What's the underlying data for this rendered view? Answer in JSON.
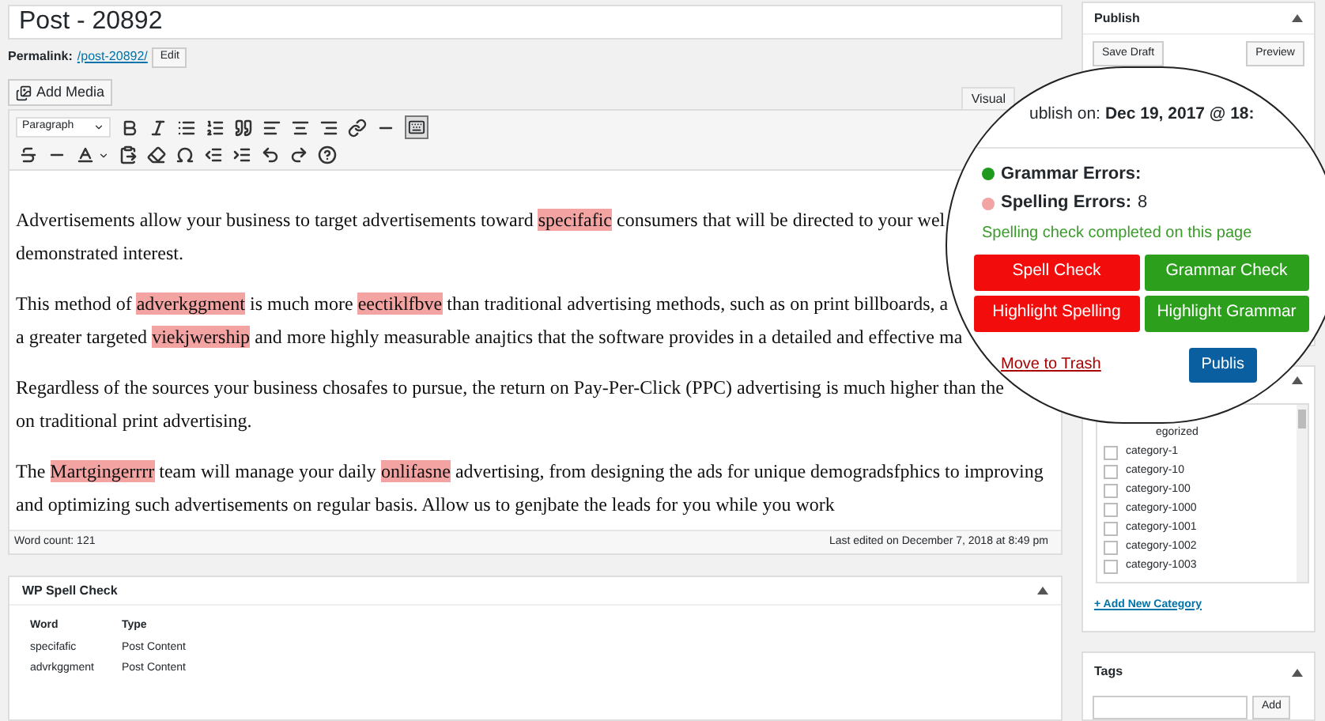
{
  "title_field": {
    "value": "Post - 20892"
  },
  "permalink": {
    "label": "Permalink:",
    "url": "/post-20892/",
    "button": "Edit"
  },
  "add_media_button": "Add Media",
  "editor_tabs": [
    {
      "label": "Visual",
      "selected": true
    }
  ],
  "toolbar": {
    "format_select": "Paragraph"
  },
  "content": {
    "paragraphs": [
      {
        "lines": [
          [
            {
              "text": "Advertisements allow your business to target advertisements toward ",
              "misspelled": false
            },
            {
              "text": "specifafic",
              "misspelled": true
            },
            {
              "text": " consumers that will be directed to your wel",
              "misspelled": false
            }
          ],
          [
            {
              "text": "demonstrated interest.",
              "misspelled": false
            }
          ]
        ]
      },
      {
        "lines": [
          [
            {
              "text": "This method of ",
              "misspelled": false
            },
            {
              "text": "adverkggment",
              "misspelled": true
            },
            {
              "text": " is much more ",
              "misspelled": false
            },
            {
              "text": "eectiklfbve",
              "misspelled": true
            },
            {
              "text": " than traditional advertising methods, such as on print billboards, a",
              "misspelled": false
            }
          ],
          [
            {
              "text": "a greater targeted ",
              "misspelled": false
            },
            {
              "text": "viekjwership",
              "misspelled": true
            },
            {
              "text": " and more highly measurable anajtics that the software provides in a detailed and effective ma",
              "misspelled": false
            }
          ]
        ]
      },
      {
        "lines": [
          [
            {
              "text": "Regardless of the sources your business chosafes to pursue, the return on Pay-Per-Click (PPC) advertising is much higher than the",
              "misspelled": false
            }
          ],
          [
            {
              "text": "on traditional print advertising.",
              "misspelled": false
            }
          ]
        ]
      },
      {
        "lines": [
          [
            {
              "text": "The ",
              "misspelled": false
            },
            {
              "text": "Martgingerrrr",
              "misspelled": true
            },
            {
              "text": " team will manage your daily ",
              "misspelled": false
            },
            {
              "text": "onlifasne",
              "misspelled": true
            },
            {
              "text": " advertising, from designing the ads for unique demogradsfphics to improving",
              "misspelled": false
            }
          ],
          [
            {
              "text": "and optimizing such advertisements on regular basis. Allow us to genjbate the leads for you while you work",
              "misspelled": false
            }
          ]
        ]
      }
    ]
  },
  "status_bar": {
    "word_count": "Word count: 121",
    "last_edited": "Last edited on December 7, 2018 at 8:49 pm"
  },
  "spell_panel": {
    "title": "WP Spell Check",
    "columns": [
      "Word",
      "Type"
    ],
    "rows": [
      [
        "specifafic",
        "Post Content"
      ],
      [
        "advrkggment",
        "Post Content"
      ]
    ]
  },
  "publish_panel": {
    "title": "Publish",
    "buttons": [
      "Save Draft",
      "Preview"
    ]
  },
  "categories_panel": {
    "items": [
      {
        "label": "egorized",
        "kind": "partial"
      },
      {
        "label": "category-1",
        "kind": "checkbox",
        "checked": false
      },
      {
        "label": "category-10",
        "kind": "checkbox",
        "checked": false
      },
      {
        "label": "category-100",
        "kind": "checkbox",
        "checked": false
      },
      {
        "label": "category-1000",
        "kind": "checkbox",
        "checked": false
      },
      {
        "label": "category-1001",
        "kind": "checkbox",
        "checked": false
      },
      {
        "label": "category-1002",
        "kind": "checkbox",
        "checked": false
      },
      {
        "label": "category-1003",
        "kind": "checkbox",
        "checked": false
      }
    ],
    "add_link": "+ Add New Category"
  },
  "tags_panel": {
    "title": "Tags",
    "button": "Add"
  },
  "magnifier": {
    "publish_on_label": "ublish on:",
    "publish_on_value": "Dec 19, 2017 @ 18:",
    "counts": [
      {
        "label": "Grammar Errors:",
        "color": "#1f9a1f"
      },
      {
        "label": "Spelling Errors:",
        "value": "8",
        "color": "#f2a3a3"
      }
    ],
    "status": "Spelling check completed on this page",
    "buttons": [
      {
        "label": "Spell Check",
        "color": "#f20c0c"
      },
      {
        "label": "Grammar Check",
        "color": "#2ca01c"
      },
      {
        "label": "Highlight Spelling",
        "color": "#f20c0c"
      },
      {
        "label": "Highlight Grammar",
        "color": "#2ca01c"
      }
    ],
    "trash_link": "Move to Trash",
    "publish_button": "Publis"
  }
}
